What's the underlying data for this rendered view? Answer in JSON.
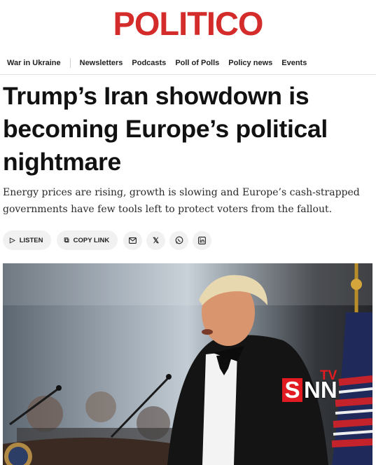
{
  "brand": {
    "logo_text": "POLITICO",
    "logo_color": "#d42b2b"
  },
  "nav": {
    "items": [
      "War in Ukraine",
      "Newsletters",
      "Podcasts",
      "Poll of Polls",
      "Policy news",
      "Events"
    ]
  },
  "article": {
    "headline": "Trump’s Iran showdown is becoming Europe’s political nightmare",
    "dek": "Energy prices are rising, growth is slowing and Europe’s cash-strapped governments have few tools left to protect voters from the fallout."
  },
  "actions": {
    "listen_label": "LISTEN",
    "copy_link_label": "COPY LINK",
    "share_icons": [
      "email-icon",
      "x-icon",
      "whatsapp-icon",
      "linkedin-icon"
    ]
  },
  "photo": {
    "watermark": {
      "letters_red": "S",
      "letters_white": "NN",
      "superscript": "TV"
    }
  }
}
